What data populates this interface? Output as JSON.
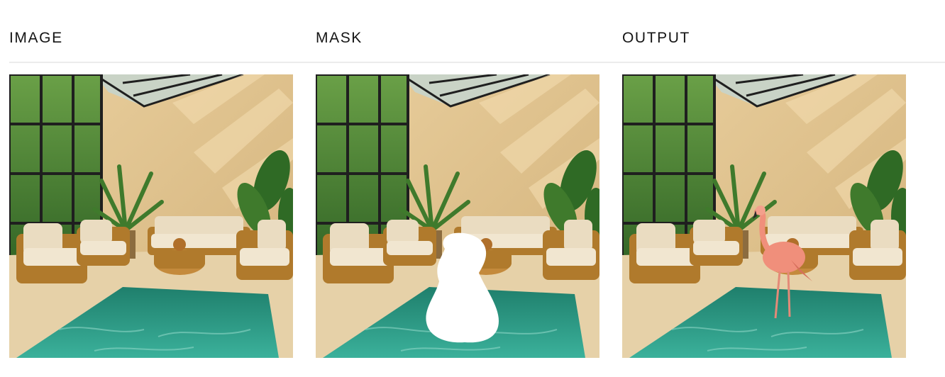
{
  "columns": [
    {
      "label": "IMAGE"
    },
    {
      "label": "MASK"
    },
    {
      "label": "OUTPUT"
    }
  ],
  "colors": {
    "wall": "#e2c490",
    "floor": "#e6d1a8",
    "pool_water": "#2e9e86",
    "window_frame": "#1f1f1f",
    "foliage": "#3f7a2c",
    "wicker": "#b07a2c",
    "cushion": "#eadcc1",
    "mask": "#ffffff",
    "flamingo": "#f08f7b"
  }
}
